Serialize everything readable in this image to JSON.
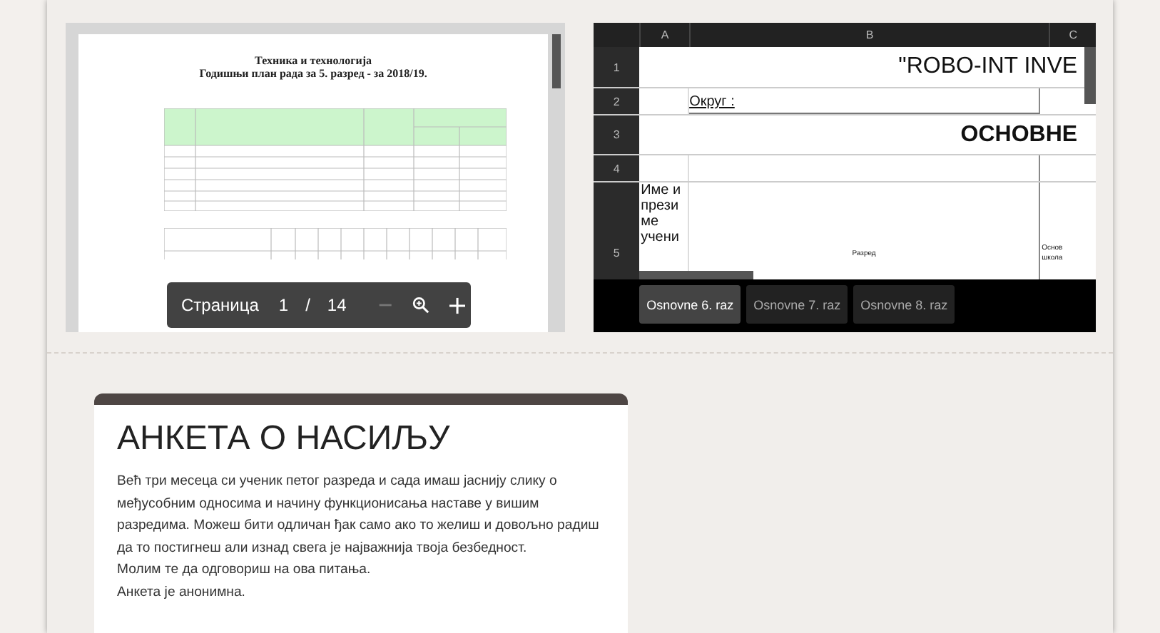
{
  "pdf_viewer": {
    "document_title": [
      "Техника и технологија",
      "Годишњи план рада за 5. разред - за 2018/19."
    ],
    "toolbar": {
      "page_label": "Страница",
      "page": "1",
      "separator": "/",
      "total": "14"
    }
  },
  "spreadsheet": {
    "columns": [
      "A",
      "B",
      "C"
    ],
    "rows": [
      {
        "number": "1",
        "kind": "title",
        "text": "\"ROBO-INT INVE"
      },
      {
        "number": "2",
        "kind": "underline",
        "text": "Округ :"
      },
      {
        "number": "3",
        "kind": "heading",
        "text": "ОСНОВНЕ"
      },
      {
        "number": "4",
        "kind": "blank",
        "text": ""
      },
      {
        "number": "5",
        "kind": "header",
        "cells": [
          "Име и прези ме учени",
          "Разред",
          "Основ школа"
        ]
      }
    ],
    "tabs": [
      {
        "label": "Osnovne 6. raz",
        "selected": true
      },
      {
        "label": "Osnovne 7. raz",
        "selected": false
      },
      {
        "label": "Osnovne 8. raz",
        "selected": false
      }
    ]
  },
  "form": {
    "title": "АНКЕТА О НАСИЉУ",
    "description": [
      "Већ три месеца си ученик петог разреда и сада имаш јаснију слику о међусобним односима и начину функционисања наставе у вишим разредима. Можеш бити одличан ђак само ако то желиш и довољно радиш да то постигнеш али изнад свега је најважнија твоја безбедност.",
      "Молим те да одговориш на ова питања.",
      "Анкета је анонимна."
    ]
  }
}
